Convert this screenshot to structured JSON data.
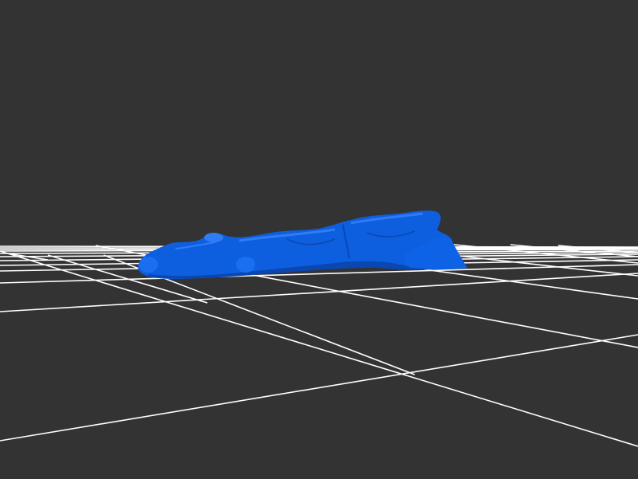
{
  "scene": {
    "background_color": "#333333",
    "grid_color": "#ffffff",
    "mesh_color": "#0d5fe0",
    "mesh_shadow_color": "#0a47b0",
    "mesh_highlight_color": "#2f7cf5",
    "object": "log-shaped-3d-mesh"
  }
}
